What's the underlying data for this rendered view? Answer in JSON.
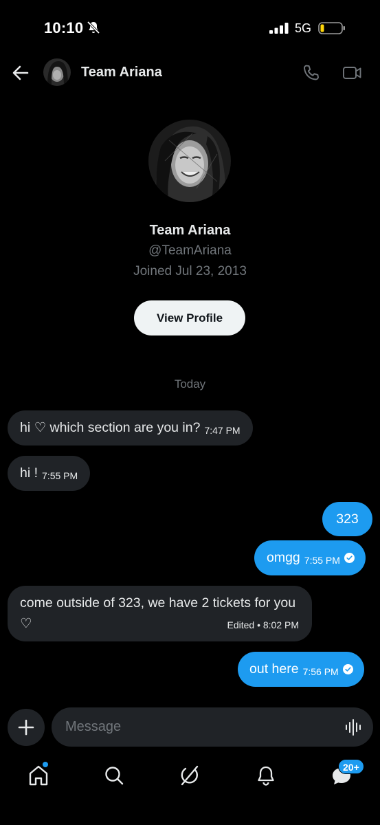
{
  "status_bar": {
    "time": "10:10",
    "network": "5G",
    "icons": [
      "bell-off-icon",
      "signal-icon",
      "battery-icon"
    ]
  },
  "header": {
    "title": "Team Ariana",
    "icons": [
      "back-arrow-icon",
      "phone-icon",
      "video-camera-icon"
    ]
  },
  "profile": {
    "name": "Team Ariana",
    "handle": "@TeamAriana",
    "joined": "Joined Jul 23, 2013",
    "button_label": "View Profile"
  },
  "day_separator": "Today",
  "messages": [
    {
      "direction": "incoming",
      "text": "hi ♡ which section are you in?",
      "time": "7:47 PM"
    },
    {
      "direction": "incoming",
      "text": "hi !",
      "time": "7:55 PM"
    },
    {
      "direction": "outgoing",
      "text": "323",
      "time": ""
    },
    {
      "direction": "outgoing",
      "text": "omgg",
      "time": "7:55 PM",
      "read": true
    },
    {
      "direction": "incoming",
      "text": "come outside of 323, we have 2 tickets for you ♡",
      "time": "Edited • 8:02 PM"
    },
    {
      "direction": "outgoing",
      "text": "out here",
      "time": "7:56 PM",
      "read": true
    }
  ],
  "composer": {
    "placeholder": "Message",
    "icons": [
      "plus-icon",
      "voice-waveform-icon"
    ]
  },
  "bottom_nav": {
    "items": [
      "home-icon",
      "search-icon",
      "grok-icon",
      "notifications-icon",
      "messages-icon"
    ],
    "messages_badge": "20+"
  },
  "colors": {
    "accent": "#1d9bf0",
    "background": "#000000",
    "incoming_bubble": "#202327",
    "muted_text": "#71767b"
  }
}
